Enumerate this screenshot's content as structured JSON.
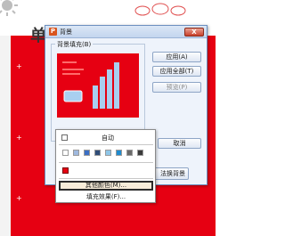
{
  "slide": {
    "title": "单"
  },
  "dialog": {
    "title": "背景",
    "close_label": "X",
    "fill_label": "背景填充(B)",
    "buttons": {
      "apply": "应用(A)",
      "apply_all": "应用全部(T)",
      "preview": "预览(P)",
      "cancel": "取消",
      "bottom_partial": "法换背景"
    }
  },
  "color_dropdown": {
    "auto_label": "自动",
    "palette": [
      "#ffffff",
      "#9fb9df",
      "#3b6fc4",
      "#2f4d78",
      "#8fc6e8",
      "#1f8bcf",
      "#6a6a6a",
      "#3a3a3a"
    ],
    "recent_color": "#e60012",
    "menu": {
      "more_colors": "其他颜色(M)...",
      "fill_effects": "填充效果(F)..."
    }
  },
  "colors": {
    "accent_red": "#e60012",
    "dialog_bg": "#eef3fb"
  }
}
